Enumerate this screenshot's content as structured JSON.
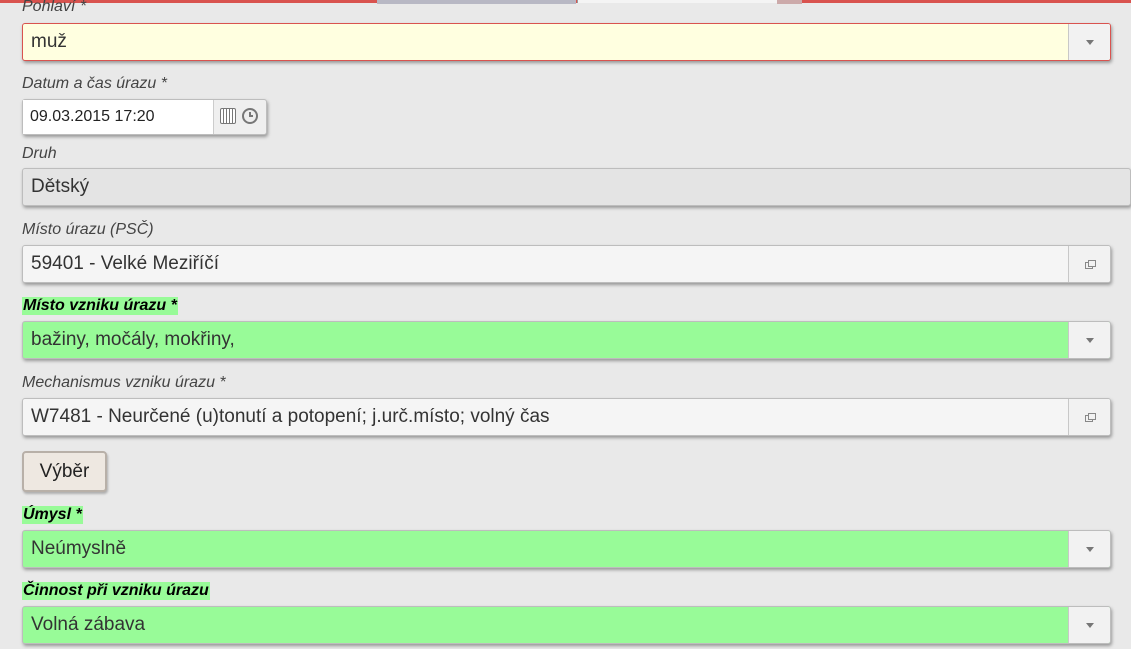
{
  "form": {
    "gender": {
      "label": "Pohlaví *",
      "value": "muž"
    },
    "datetime": {
      "label": "Datum a čas úrazu *",
      "value": "09.03.2015 17:20"
    },
    "type": {
      "label": "Druh",
      "value": "Dětský"
    },
    "place_psc": {
      "label": "Místo úrazu (PSČ)",
      "value": "59401 - Velké Meziříčí"
    },
    "place_origin": {
      "label": "Místo vzniku úrazu *",
      "value": "bažiny, močály, mokřiny,"
    },
    "mechanism": {
      "label": "Mechanismus vzniku úrazu *",
      "value": "W7481 - Neurčené (u)tonutí a potopení; j.urč.místo; volný čas"
    },
    "select_button": "Výběr",
    "intent": {
      "label": "Úmysl *",
      "value": "Neúmyslně"
    },
    "activity": {
      "label": "Činnost při vzniku úrazu",
      "value": "Volná zábava"
    }
  },
  "colors": {
    "required_highlight": "#98fb98",
    "error_field": "#ffffe0",
    "top_bar": "#d9534f"
  }
}
